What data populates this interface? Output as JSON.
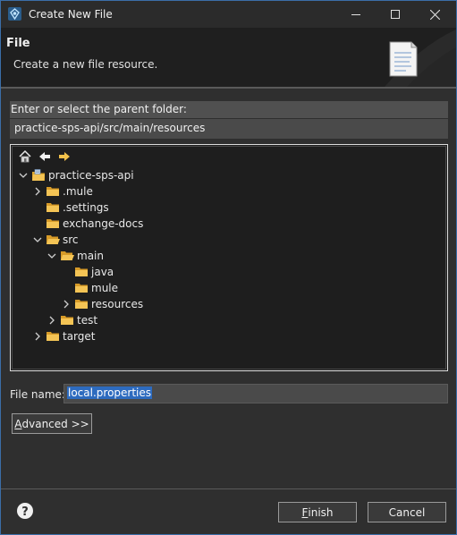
{
  "window": {
    "title": "Create New File",
    "minimize_icon": "minimize-icon",
    "maximize_icon": "maximize-icon",
    "close_icon": "close-icon"
  },
  "banner": {
    "title": "File",
    "description": "Create a new file resource."
  },
  "parent": {
    "label": "Enter or select the parent folder:",
    "path": "practice-sps-api/src/main/resources"
  },
  "tree": {
    "toolbar": [
      "home-icon",
      "back-icon",
      "forward-icon"
    ],
    "items": [
      {
        "label": "practice-sps-api",
        "depth": 0,
        "twisty": "expanded",
        "icon": "project-icon"
      },
      {
        "label": ".mule",
        "depth": 1,
        "twisty": "collapsed",
        "icon": "folder-icon"
      },
      {
        "label": ".settings",
        "depth": 1,
        "twisty": "none",
        "icon": "folder-icon"
      },
      {
        "label": "exchange-docs",
        "depth": 1,
        "twisty": "none",
        "icon": "folder-icon"
      },
      {
        "label": "src",
        "depth": 1,
        "twisty": "expanded",
        "icon": "folder-icon"
      },
      {
        "label": "main",
        "depth": 2,
        "twisty": "expanded",
        "icon": "folder-icon"
      },
      {
        "label": "java",
        "depth": 3,
        "twisty": "none",
        "icon": "folder-icon"
      },
      {
        "label": "mule",
        "depth": 3,
        "twisty": "none",
        "icon": "folder-icon"
      },
      {
        "label": "resources",
        "depth": 3,
        "twisty": "collapsed",
        "icon": "folder-icon"
      },
      {
        "label": "test",
        "depth": 2,
        "twisty": "collapsed",
        "icon": "folder-icon"
      },
      {
        "label": "target",
        "depth": 1,
        "twisty": "collapsed",
        "icon": "folder-icon"
      }
    ]
  },
  "file_name": {
    "label": "File name:",
    "value": "local.properties"
  },
  "advanced": {
    "mnemonic": "A",
    "rest": "dvanced >>"
  },
  "footer": {
    "help_icon": "help-icon",
    "finish_mnemonic": "F",
    "finish_rest": "inish",
    "cancel_label": "Cancel"
  }
}
